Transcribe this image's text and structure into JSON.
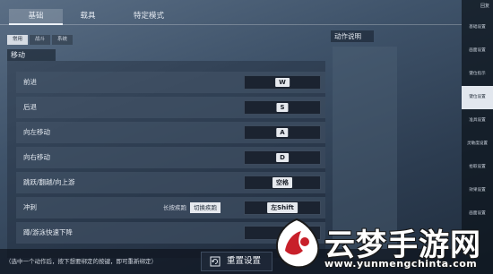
{
  "tabs": [
    {
      "label": "基础",
      "active": true
    },
    {
      "label": "载具",
      "active": false
    },
    {
      "label": "特定模式",
      "active": false
    }
  ],
  "subtabs": [
    {
      "label": "常用",
      "active": true
    },
    {
      "label": "战斗",
      "active": false
    },
    {
      "label": "系统",
      "active": false
    }
  ],
  "section": {
    "title": "移动"
  },
  "bindings": [
    {
      "label": "前进",
      "key": "W"
    },
    {
      "label": "后退",
      "key": "S"
    },
    {
      "label": "向左移动",
      "key": "A"
    },
    {
      "label": "向右移动",
      "key": "D"
    },
    {
      "label": "跳跃/翻越/向上游",
      "key": "空格"
    },
    {
      "label": "冲刺",
      "key": "左Shift",
      "toggle": [
        "长按疾跑",
        "切换疾跑"
      ],
      "toggle_selected": "切换疾跑"
    },
    {
      "label": "蹲/游泳快速下降",
      "key": ""
    }
  ],
  "side": {
    "title": "动作说明"
  },
  "nav": {
    "top": "回复",
    "items": [
      {
        "label": "基础设置",
        "active": false
      },
      {
        "label": "画面设置",
        "active": false
      },
      {
        "label": "键位指示",
        "active": false
      },
      {
        "label": "键位设置",
        "active": true
      },
      {
        "label": "准具设置",
        "active": false
      },
      {
        "label": "灵敏度设置",
        "active": false
      },
      {
        "label": "拾取设置",
        "active": false
      },
      {
        "label": "效果设置",
        "active": false
      },
      {
        "label": "画面设置",
        "active": false
      }
    ]
  },
  "footer": {
    "hint": "（选中一个动作后，按下想要绑定的按键，即可重新绑定）",
    "reset_label": "重置设置"
  },
  "watermark": {
    "name": "云梦手游网",
    "url": "www.yunmengchinta.com"
  }
}
